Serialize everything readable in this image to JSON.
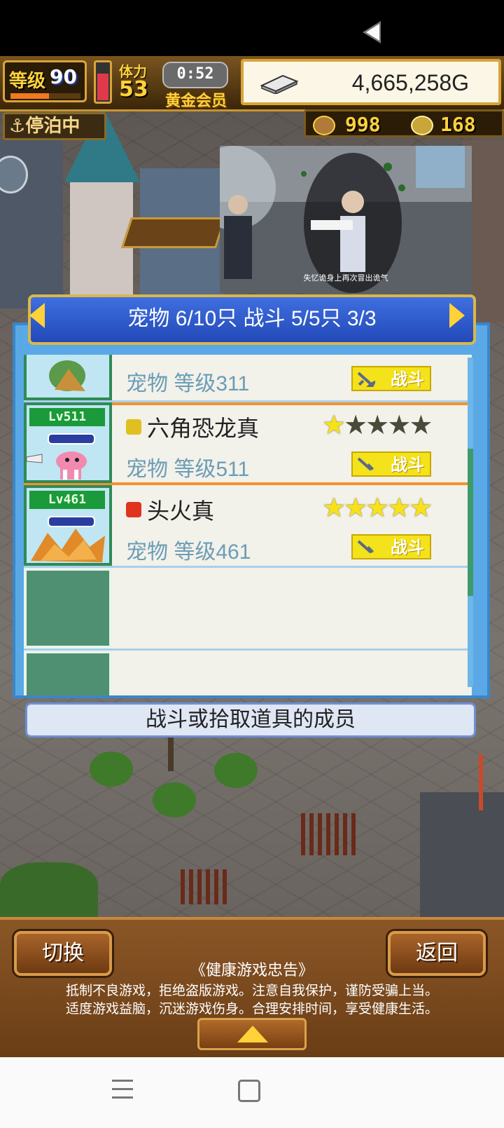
{
  "hud": {
    "level_label": "等级",
    "level_value": "90",
    "level_progress": 0.55,
    "stamina_fill": 0.75,
    "stamina_label": "体力",
    "stamina_value": "53",
    "timer": "0:52",
    "membership": "黄金会员",
    "gold": "4,665,258G",
    "dock_status": "停泊中",
    "resource_1": "998",
    "resource_2": "168"
  },
  "video": {
    "caption": "失忆诡身上再次冒出诡气"
  },
  "pets": {
    "header": "宠物 6/10只 战斗 5/5只  3/3",
    "rows": [
      {
        "lv_tag": "",
        "name": "",
        "level_text": "宠物 等级311",
        "stars": 0,
        "battle": "战斗",
        "element_color": ""
      },
      {
        "lv_tag": "Lv511",
        "name": "六角恐龙真",
        "level_text": "宠物 等级511",
        "stars": 1,
        "battle": "战斗",
        "element_color": "#e0c020"
      },
      {
        "lv_tag": "Lv461",
        "name": "头火真",
        "level_text": "宠物 等级461",
        "stars": 5,
        "battle": "战斗",
        "element_color": "#e0341e"
      }
    ],
    "info": "战斗或拾取道具的成员"
  },
  "bottom": {
    "switch_label": "切换",
    "back_label": "返回",
    "notice_title": "《健康游戏忠告》",
    "notice_line1": "抵制不良游戏，拒绝盗版游戏。注意自我保护，谨防受骗上当。",
    "notice_line2": "适度游戏益脑，沉迷游戏伤身。合理安排时间，享受健康生活。"
  },
  "colors": {
    "header_blue": "#2f5fd0",
    "gold_frame": "#d9a43a",
    "selected_outline": "#f2922e",
    "battle_yellow": "#f4e21a"
  }
}
